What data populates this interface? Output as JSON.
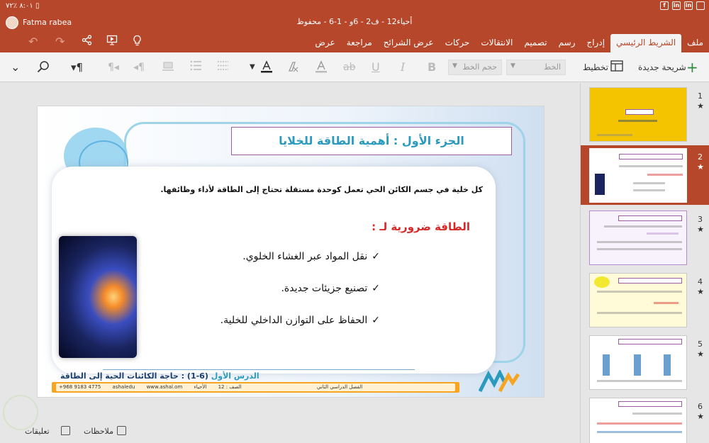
{
  "status": {
    "left": "٨:٠١ ٪٧٢ ▯"
  },
  "titlebar": {
    "user": "Fatma rabea",
    "doc_title": "أحياء12 - ف2 - 6و - 1-6 - محفوظ"
  },
  "tabs": [
    {
      "label": "ملف",
      "active": false
    },
    {
      "label": "الشريط الرئيسي",
      "active": true
    },
    {
      "label": "إدراج",
      "active": false
    },
    {
      "label": "رسم",
      "active": false
    },
    {
      "label": "تصميم",
      "active": false
    },
    {
      "label": "الانتقالات",
      "active": false
    },
    {
      "label": "حركات",
      "active": false
    },
    {
      "label": "عرض الشرائح",
      "active": false
    },
    {
      "label": "مراجعة",
      "active": false
    },
    {
      "label": "عرض",
      "active": false
    }
  ],
  "toolbar": {
    "new_slide": "شريحة جديدة",
    "layout": "تخطيط",
    "font_placeholder": "الخط",
    "font_size_placeholder": "حجم الخط"
  },
  "slide": {
    "title": "الجزء الأول : أهمية الطاقة للخلايا",
    "intro": "كل خلية في جسم الكائن الحي تعمل كوحدة مستقلة تحتاج إلى الطاقة لأداء وظائفها.",
    "subheading": "الطاقة ضرورية لـ :",
    "bullets": [
      "نقل المواد عبر الغشاء الخلوي.",
      "تصنيع جزيئات جديدة.",
      "الحفاظ على التوازن الداخلي للخلية."
    ],
    "check": "✓",
    "lesson_label": "الدرس الأول",
    "lesson_title": "(6-1) : حاجة الكائنات الحية إلى الطاقة",
    "footer_items": [
      "+968 9183 4775",
      "ashaledu",
      "www.ashal.om",
      "الفصل الدراسي الثاني",
      "الصف : 12",
      "الأحياء"
    ]
  },
  "bottombar": {
    "notes": "ملاحظات",
    "comments": "تعليقات"
  },
  "thumbnails": [
    {
      "num": "1",
      "star": "★",
      "selected": false,
      "color": "#f5c400"
    },
    {
      "num": "2",
      "star": "★",
      "selected": true,
      "color": "#ffffff"
    },
    {
      "num": "3",
      "star": "★",
      "selected": false,
      "color": "#f7f2fb"
    },
    {
      "num": "4",
      "star": "★",
      "selected": false,
      "color": "#fffbd8"
    },
    {
      "num": "5",
      "star": "★",
      "selected": false,
      "color": "#ffffff"
    },
    {
      "num": "6",
      "star": "★",
      "selected": false,
      "color": "#ffffff"
    }
  ],
  "colors": {
    "accent": "#b7472a",
    "title_text": "#2a9bbf",
    "subheading": "#d62929"
  }
}
